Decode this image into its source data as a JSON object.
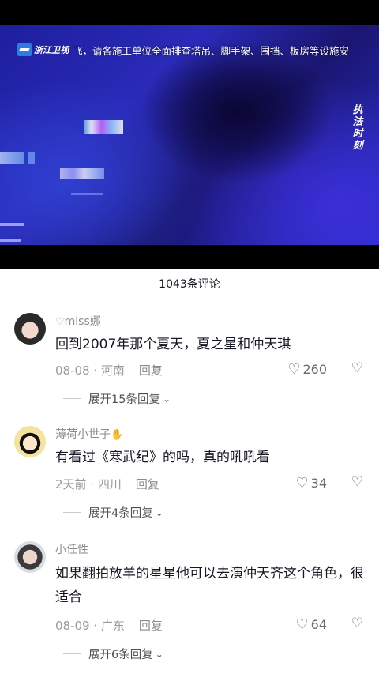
{
  "video": {
    "channel": "浙江卫视",
    "ticker": "飞，请各施工单位全面排查塔吊、脚手架、围挡、板房等设施安",
    "side_tag": "执法时刻"
  },
  "comments_header": {
    "count_text": "1043条评论"
  },
  "comments": [
    {
      "username": "miss娜",
      "text": "回到2007年那个夏天，夏之星和仲天琪",
      "date_location": "08-08 · 河南",
      "reply_label": "回复",
      "likes": "260",
      "expand_label": "展开15条回复"
    },
    {
      "username": "薄荷小世子",
      "text": "有看过《寒武纪》的吗，真的吼吼看",
      "date_location": "2天前 · 四川",
      "reply_label": "回复",
      "likes": "34",
      "expand_label": "展开4条回复"
    },
    {
      "username": "小任性",
      "text": "如果翻拍放羊的星星他可以去演仲天齐这个角色，很适合",
      "date_location": "08-09 · 广东",
      "reply_label": "回复",
      "likes": "64",
      "expand_label": "展开6条回复"
    }
  ],
  "icons": {
    "heart": "heart-outline-icon",
    "dislike": "broken-heart-icon",
    "chevron": "chevron-down-icon"
  }
}
